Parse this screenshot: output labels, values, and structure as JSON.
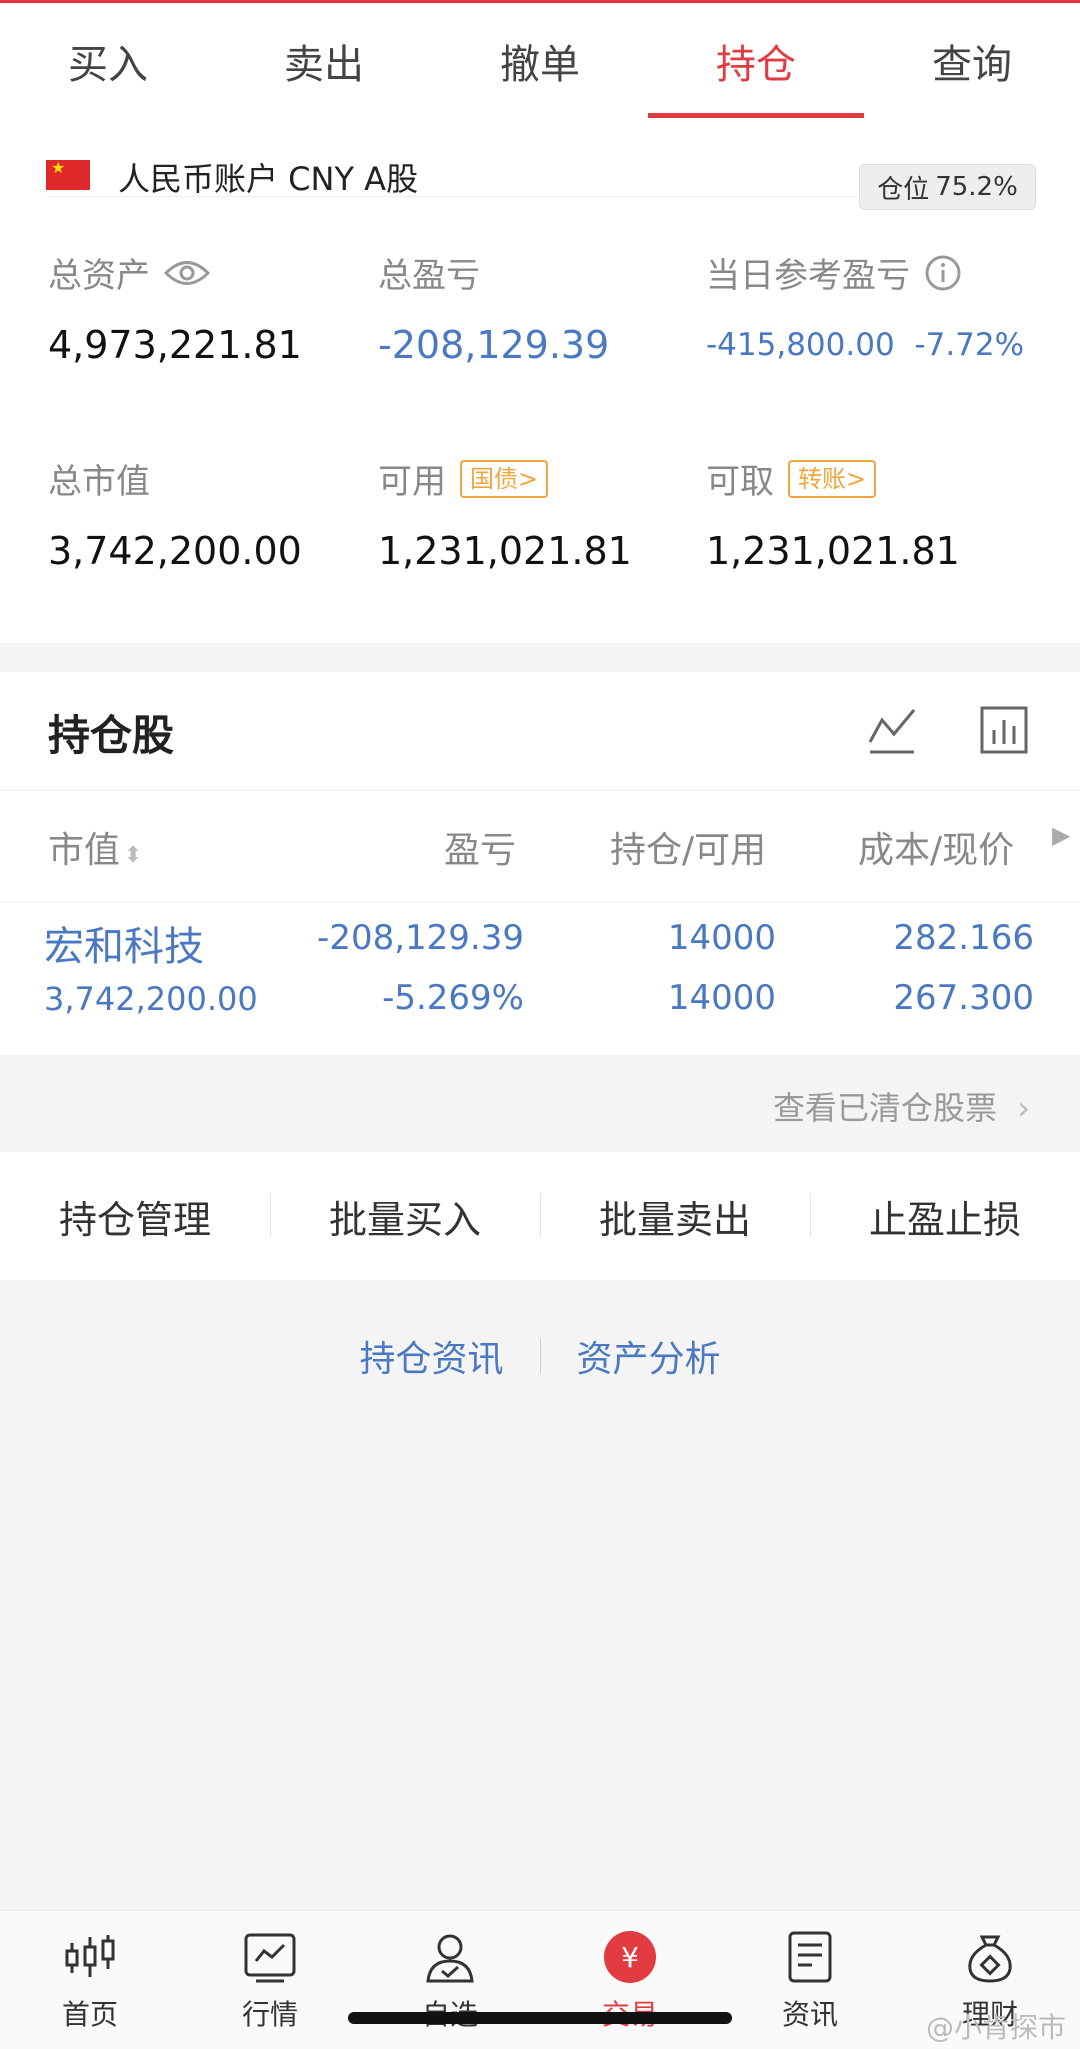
{
  "tabs": [
    "买入",
    "卖出",
    "撤单",
    "持仓",
    "查询"
  ],
  "active_tab": 3,
  "account": {
    "name": "人民币账户 CNY A股",
    "position_label": "仓位",
    "position_value": "75.2%"
  },
  "metrics": {
    "total_assets": {
      "label": "总资产",
      "value": "4,973,221.81"
    },
    "total_pnl": {
      "label": "总盈亏",
      "value": "-208,129.39"
    },
    "daily_pnl": {
      "label": "当日参考盈亏",
      "value": "-415,800.00",
      "pct": "-7.72%"
    },
    "market_value": {
      "label": "总市值",
      "value": "3,742,200.00"
    },
    "available": {
      "label": "可用",
      "tag": "国债>",
      "value": "1,231,021.81"
    },
    "withdrawable": {
      "label": "可取",
      "tag": "转账>",
      "value": "1,231,021.81"
    }
  },
  "holdings": {
    "title": "持仓股",
    "headers": [
      "市值",
      "盈亏",
      "持仓/可用",
      "成本/现价"
    ],
    "rows": [
      {
        "name": "宏和科技",
        "market_value": "3,742,200.00",
        "pnl": "-208,129.39",
        "pnl_pct": "-5.269%",
        "position": "14000",
        "available": "14000",
        "cost": "282.166",
        "price": "267.300"
      }
    ]
  },
  "cleared_link": "查看已清仓股票",
  "actions": [
    "持仓管理",
    "批量买入",
    "批量卖出",
    "止盈止损"
  ],
  "links": [
    "持仓资讯",
    "资产分析"
  ],
  "bottom_nav": [
    "首页",
    "行情",
    "自选",
    "交易",
    "资讯",
    "理财"
  ],
  "watermark": "@小肯探市",
  "colors": {
    "accent": "#e23b41",
    "blue": "#4a78c2",
    "orange": "#f0a63a"
  }
}
